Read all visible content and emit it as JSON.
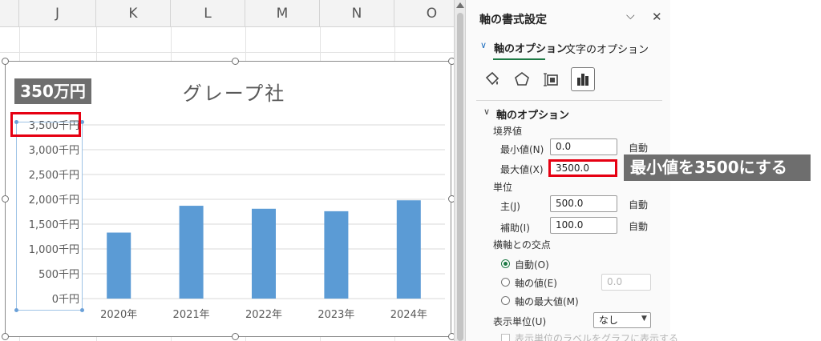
{
  "sheet": {
    "columns": [
      "J",
      "K",
      "L",
      "M",
      "N",
      "O"
    ]
  },
  "chart": {
    "callout_value": "350万円",
    "chart_data": {
      "type": "bar",
      "title": "グレープ社",
      "categories": [
        "2020年",
        "2021年",
        "2022年",
        "2023年",
        "2024年"
      ],
      "values": [
        1330,
        1870,
        1810,
        1760,
        1980
      ],
      "y_ticks": [
        "0千円",
        "500千円",
        "1,000千円",
        "1,500千円",
        "2,000千円",
        "2,500千円",
        "3,000千円",
        "3,500千円"
      ],
      "ylim": [
        0,
        3500
      ],
      "y_major_unit": 500,
      "grid": true,
      "legend": "none",
      "bar_color": "#5b9bd5"
    }
  },
  "pane": {
    "title": "軸の書式設定",
    "dropdown_icon": "chevron-down-icon",
    "close_icon": "close-icon",
    "tabs": {
      "axis_options": "軸のオプション",
      "text_options": "文字のオプション"
    },
    "section_title": "軸のオプション",
    "bounds_label": "境界値",
    "min_label": "最小値(N)",
    "min_value": "0.0",
    "min_auto": "自動",
    "max_label": "最大値(X)",
    "max_value": "3500.0",
    "units_label": "単位",
    "major_label": "主(J)",
    "major_value": "500.0",
    "major_auto": "自動",
    "minor_label": "補助(I)",
    "minor_value": "100.0",
    "minor_auto": "自動",
    "crosses_label": "横軸との交点",
    "crosses_auto": "自動(O)",
    "crosses_value_label": "軸の値(E)",
    "crosses_value": "0.0",
    "crosses_max": "軸の最大値(M)",
    "display_units_label": "表示単位(U)",
    "display_units_value": "なし",
    "show_units_label": "表示単位のラベルをグラフに表示する",
    "annotation": "最小値を3500にする",
    "accent_color": "#1e7a45",
    "highlight_color": "#e60012"
  }
}
